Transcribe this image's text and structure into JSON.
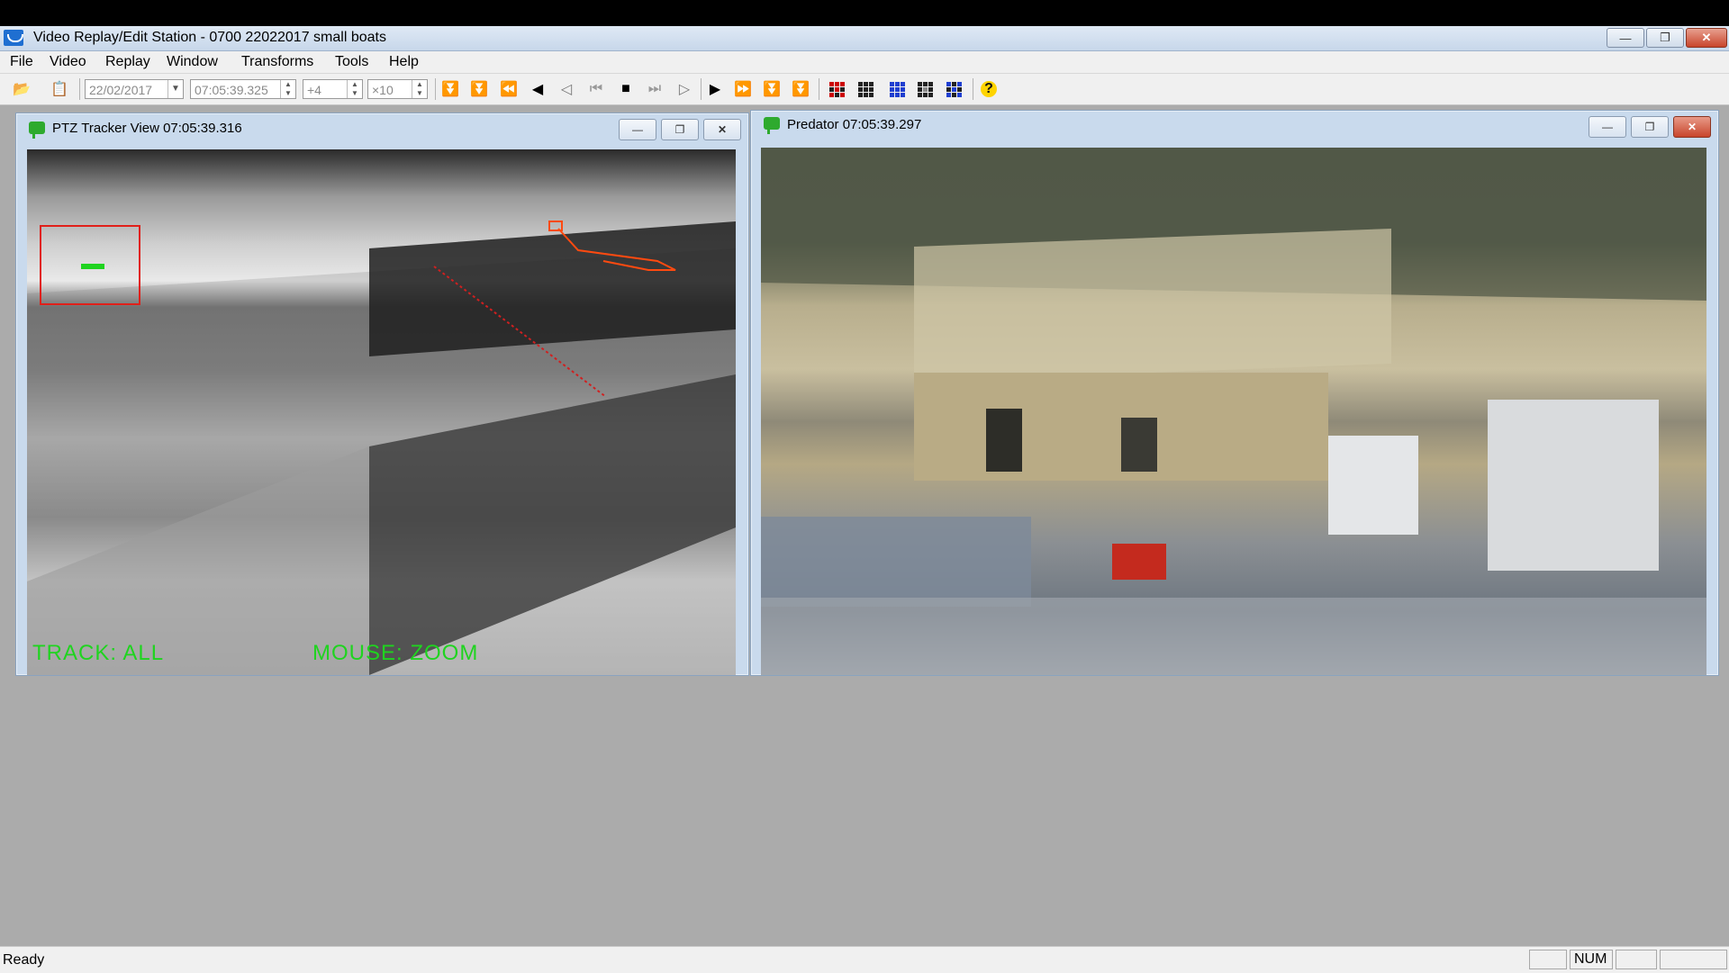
{
  "window": {
    "title": "Video Replay/Edit Station - 0700 22022017 small boats"
  },
  "menu": [
    {
      "label": "File"
    },
    {
      "label": "Video"
    },
    {
      "label": "Replay"
    },
    {
      "label": "Window"
    },
    {
      "label": "Transforms"
    },
    {
      "label": "Tools"
    },
    {
      "label": "Help"
    }
  ],
  "toolbar": {
    "date": "22/02/2017",
    "time": "07:05:39.325",
    "step": "+4",
    "speed": "×10"
  },
  "ptz_view": {
    "title": "PTZ Tracker View 07:05:39.316",
    "overlay_left": "TRACK: ALL",
    "overlay_right": "MOUSE: ZOOM"
  },
  "predator_view": {
    "title": "Predator 07:05:39.297"
  },
  "status": {
    "text": "Ready",
    "num": "NUM"
  },
  "colors": {
    "overlay_green": "#1fd41f",
    "track_red": "#e0201a",
    "track_orange": "#ff4a10"
  }
}
